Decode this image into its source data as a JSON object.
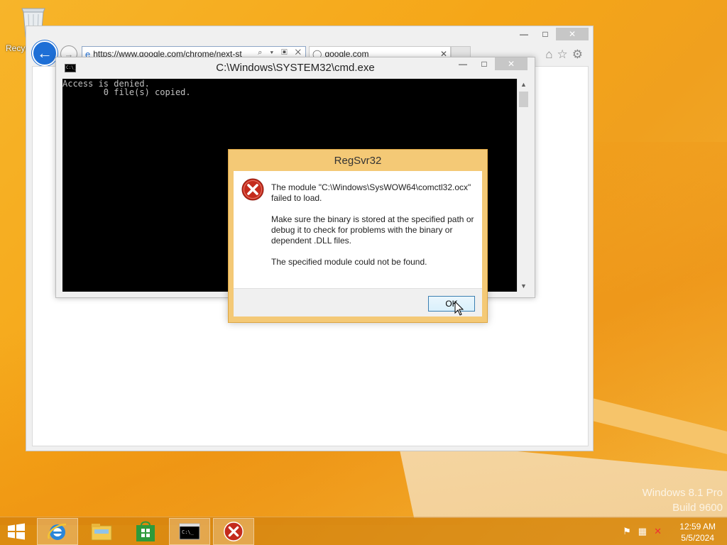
{
  "desktop": {
    "recycle_label": "Recycle Bin",
    "watermark_line1": "Windows 8.1 Pro",
    "watermark_line2": "Build 9600"
  },
  "ie": {
    "address": "https://www.google.com/chrome/next-st",
    "address_icons": "⌕ ▾ ▣ ✕",
    "tab_label": "google.com",
    "tab_close": "✕",
    "back_glyph": "←",
    "forward_glyph": "→",
    "tools": {
      "home": "⌂",
      "favorites": "☆",
      "settings": "⚙"
    },
    "caption": {
      "minimize": "—",
      "maximize": "□",
      "close": "✕"
    }
  },
  "cmd": {
    "title": "C:\\Windows\\SYSTEM32\\cmd.exe",
    "icon_text": "C:\\_",
    "console_line1": "Access is denied.",
    "console_line2": "        0 file(s) copied.",
    "caption": {
      "minimize": "—",
      "maximize": "□",
      "close": "✕"
    },
    "scroll_up": "▲",
    "scroll_down": "▼"
  },
  "dialog": {
    "title": "RegSvr32",
    "message1": "The module \"C:\\Windows\\SysWOW64\\comctl32.ocx\" failed to load.",
    "message2": "Make sure the binary is stored at the specified path or debug it to check for problems with the binary or dependent .DLL files.",
    "message3": "The specified module could not be found.",
    "ok_label": "OK"
  },
  "taskbar": {
    "tray_flag": "⚑",
    "tray_network": "▦",
    "tray_volume": "✕",
    "time": "12:59 AM",
    "date": "5/5/2024"
  },
  "colors": {
    "desktop": "#f5a618",
    "dialog_frame": "#f4c976",
    "error_red": "#c42b1c",
    "ie_blue": "#1e6fd6"
  }
}
